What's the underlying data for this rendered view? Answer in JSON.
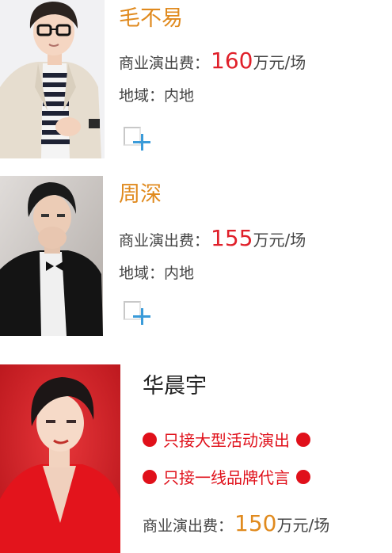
{
  "colors": {
    "name_orange": "#e08a1e",
    "fee_red": "#e0202a",
    "fee_orange": "#e08a1e",
    "tag_red": "#e0101a",
    "plus_blue": "#3a9bd9"
  },
  "artists": [
    {
      "name": "毛不易",
      "fee_label": "商业演出费：",
      "fee_value": "160",
      "fee_unit": "万元/场",
      "region_label": "地域：",
      "region_value": "内地",
      "add_icon": "plus-icon"
    },
    {
      "name": "周深",
      "fee_label": "商业演出费：",
      "fee_value": "155",
      "fee_unit": "万元/场",
      "region_label": "地域：",
      "region_value": "内地",
      "add_icon": "plus-icon"
    },
    {
      "name": "华晨宇",
      "tags": [
        "只接大型活动演出",
        "只接一线品牌代言"
      ],
      "fee_label": "商业演出费：",
      "fee_value": "150",
      "fee_unit": "万元/场"
    }
  ]
}
